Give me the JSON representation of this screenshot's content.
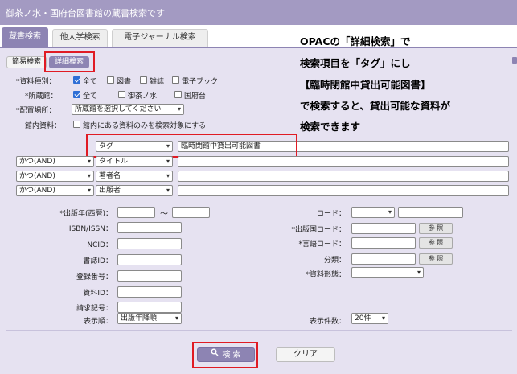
{
  "window": {
    "title": "御茶ノ水・国府台図書館の蔵書検索です"
  },
  "tabs": [
    "蔵書検索",
    "他大学検索",
    "電子ジャーナル検索"
  ],
  "mode_buttons": {
    "simple": "簡易検索",
    "detailed": "詳細検索"
  },
  "material_type": {
    "label": "*資料種別：",
    "options": [
      {
        "label": "全て",
        "checked": true
      },
      {
        "label": "図書",
        "checked": false
      },
      {
        "label": "雑誌",
        "checked": false
      },
      {
        "label": "電子ブック",
        "checked": false
      }
    ]
  },
  "library": {
    "label": "*所蔵館：",
    "options": [
      {
        "label": "全て",
        "checked": true
      },
      {
        "label": "御茶ノ水",
        "checked": false
      },
      {
        "label": "国府台",
        "checked": false
      }
    ]
  },
  "location": {
    "label": "*配置場所：",
    "value": "所蔵館を選択してください"
  },
  "in_library": {
    "label": "館内資料：",
    "checkbox_label": "館内にある資料のみを検索対象にする",
    "checked": false
  },
  "search_rows": [
    {
      "operator": "",
      "field": "タグ",
      "value": "臨時閉館中貸出可能図書"
    },
    {
      "operator": "かつ(AND)",
      "field": "タイトル",
      "value": ""
    },
    {
      "operator": "かつ(AND)",
      "field": "著者名",
      "value": ""
    },
    {
      "operator": "かつ(AND)",
      "field": "出版者",
      "value": ""
    }
  ],
  "fields": {
    "pub_year": {
      "label": "*出版年(西暦)：",
      "separator": "〜"
    },
    "isbn": {
      "label": "ISBN/ISSN："
    },
    "ncid": {
      "label": "NCID："
    },
    "biblio_id": {
      "label": "書誌ID："
    },
    "reg_no": {
      "label": "登録番号："
    },
    "material_id": {
      "label": "資料ID："
    },
    "call_no": {
      "label": "請求記号："
    },
    "code": {
      "label": "コード："
    },
    "country_code": {
      "label": "*出版国コード："
    },
    "lang_code": {
      "label": "*言語コード："
    },
    "classification": {
      "label": "分類："
    },
    "form": {
      "label": "*資料形態："
    },
    "sort": {
      "label": "表示順：",
      "value": "出版年降順"
    },
    "count": {
      "label": "表示件数：",
      "value": "20件"
    }
  },
  "ref_label": "参 照",
  "actions": {
    "search": "検 索",
    "clear": "クリア"
  },
  "annotation": {
    "lines": [
      "OPACの「詳細検索」で",
      "検索項目を「タグ」にし",
      "【臨時閉館中貸出可能図書】",
      "で検索すると、貸出可能な資料が",
      "検索できます"
    ]
  },
  "icons": {
    "search": "magnifier-icon",
    "dropdown": "chevron-down-icon"
  },
  "colors": {
    "accent": "#8d84b3",
    "title_bar": "#a39ac2",
    "panel": "#e6e2f1",
    "highlight": "#e01b24",
    "checkbox": "#2f6fd6"
  }
}
